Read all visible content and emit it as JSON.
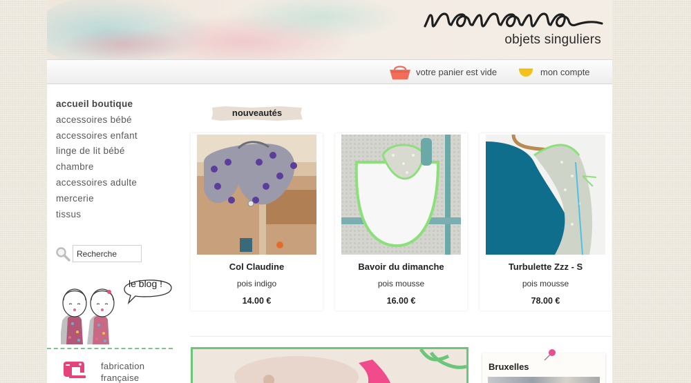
{
  "header": {
    "logo_text": "nanana",
    "tagline": "objets singuliers"
  },
  "topbar": {
    "cart_label": "votre panier est vide",
    "account_label": "mon compte"
  },
  "sidebar": {
    "categories": [
      {
        "label": "accueil boutique",
        "active": true
      },
      {
        "label": "accessoires bébé"
      },
      {
        "label": "accessoires enfant"
      },
      {
        "label": "linge de lit bébé"
      },
      {
        "label": "chambre"
      },
      {
        "label": "accessoires adulte"
      },
      {
        "label": "mercerie"
      },
      {
        "label": "tissus"
      }
    ],
    "search_value": "Recherche",
    "blog_label": "le blog !",
    "fabrication_label_line1": "fabrication",
    "fabrication_label_line2": "française"
  },
  "main": {
    "section_title": "nouveautés",
    "products": [
      {
        "name": "Col Claudine",
        "variant": "pois indigo",
        "price": "14.00 €"
      },
      {
        "name": "Bavoir du dimanche",
        "variant": "pois mousse",
        "price": "16.00 €"
      },
      {
        "name": "Turbulette Zzz - S",
        "variant": "pois mousse",
        "price": "78.00 €"
      }
    ],
    "bruxelles_label": "Bruxelles"
  },
  "colors": {
    "accent_green": "#7cc58a",
    "cart_icon": "#f26c5a",
    "account_icon": "#f3c21a"
  }
}
